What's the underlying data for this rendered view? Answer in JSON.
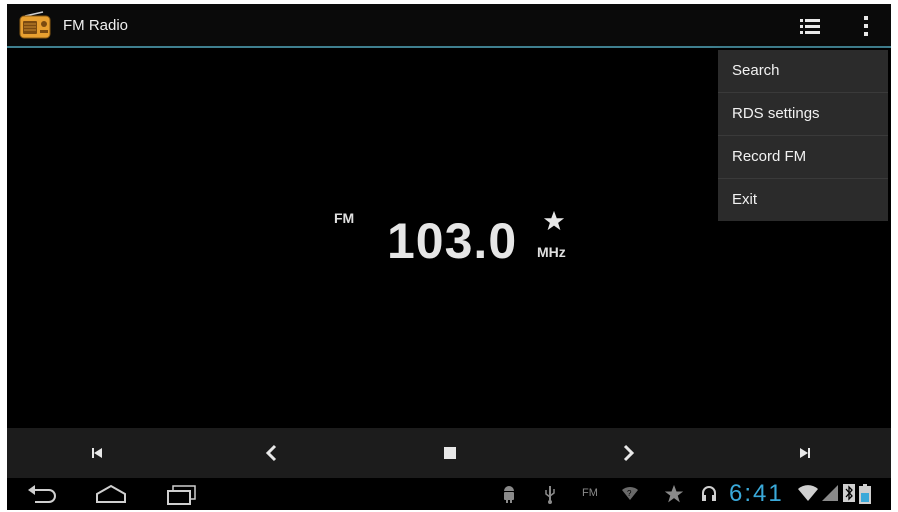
{
  "app": {
    "title": "FM Radio"
  },
  "menu": {
    "items": [
      "Search",
      "RDS settings",
      "Record FM",
      "Exit"
    ]
  },
  "tuner": {
    "band": "FM",
    "frequency": "103.0",
    "unit": "MHz"
  },
  "status": {
    "time": "6:41",
    "fm_indicator": "FM"
  },
  "colors": {
    "accent": "#3f7f8f",
    "clock": "#3aa9d9",
    "app_icon": "#e8a030"
  }
}
